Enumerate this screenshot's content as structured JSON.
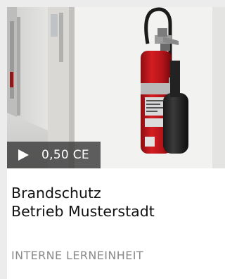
{
  "course_card": {
    "image_alt": "Feuerlöscher an der Wand",
    "credits_label": "0,50 CE",
    "title_line1": "Brandschutz",
    "title_line2": "Betrieb Musterstadt",
    "type_label": "INTERNE LERNEINHEIT"
  },
  "icons": {
    "play": "play-icon",
    "image": "fire-extinguisher-photo"
  },
  "colors": {
    "badge_bg": "#3c3c3c",
    "title": "#111111",
    "type_label": "#8a8a8a",
    "extinguisher_red": "#c4151c"
  }
}
